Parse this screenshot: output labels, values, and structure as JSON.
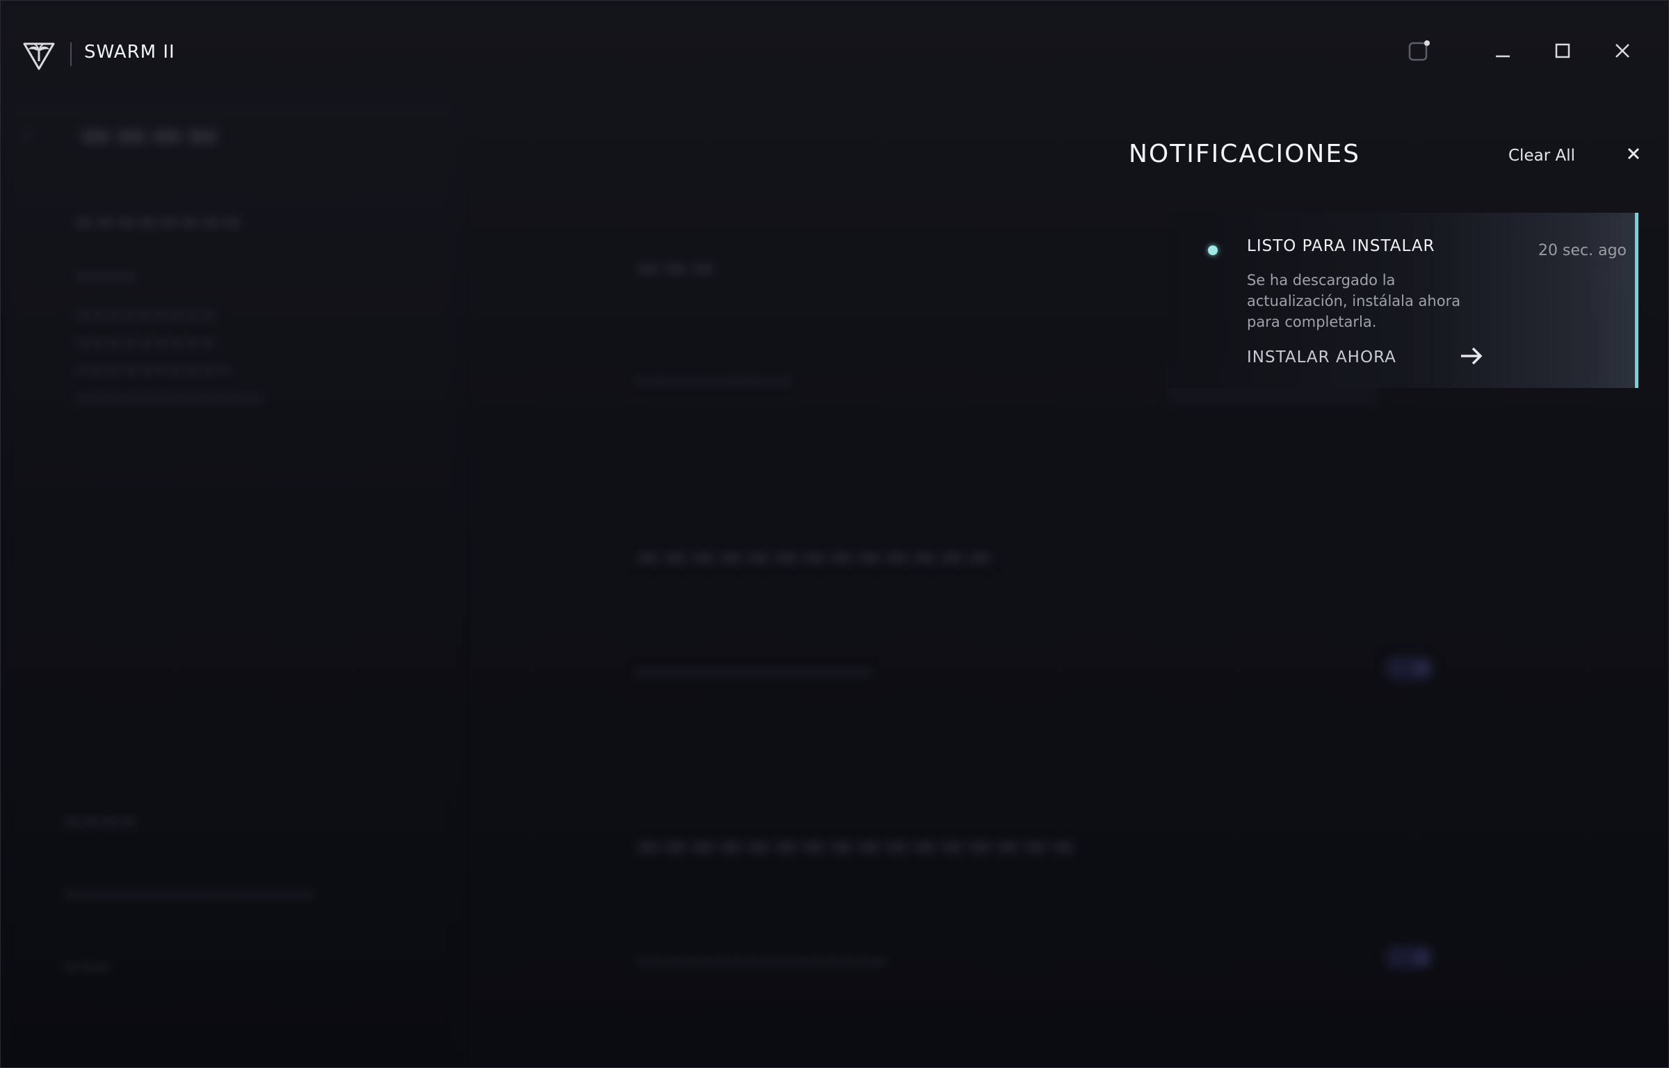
{
  "window": {
    "app_title": "SWARM II",
    "logo_icon": "turtle-beach-logo-icon",
    "controls": [
      "notification-bell-icon",
      "minimize-icon",
      "maximize-icon",
      "close-icon"
    ]
  },
  "notifications_panel": {
    "title": "NOTIFICACIONES",
    "clear_all_label": "Clear All",
    "close_icon": "close-icon",
    "items": [
      {
        "title": "LISTO PARA INSTALAR",
        "time": "20 sec. ago",
        "body": "Se ha descargado la actualización, instálala ahora para completarla.",
        "action_label": "INSTALAR AHORA",
        "action_icon": "arrow-right-icon",
        "unread": true,
        "accent_color": "#6fd3e0"
      }
    ]
  },
  "colors": {
    "background": "#0d0e13",
    "accent": "#6fd3e0",
    "text_primary": "#f1f2f5",
    "text_secondary": "#9fa1ab"
  }
}
